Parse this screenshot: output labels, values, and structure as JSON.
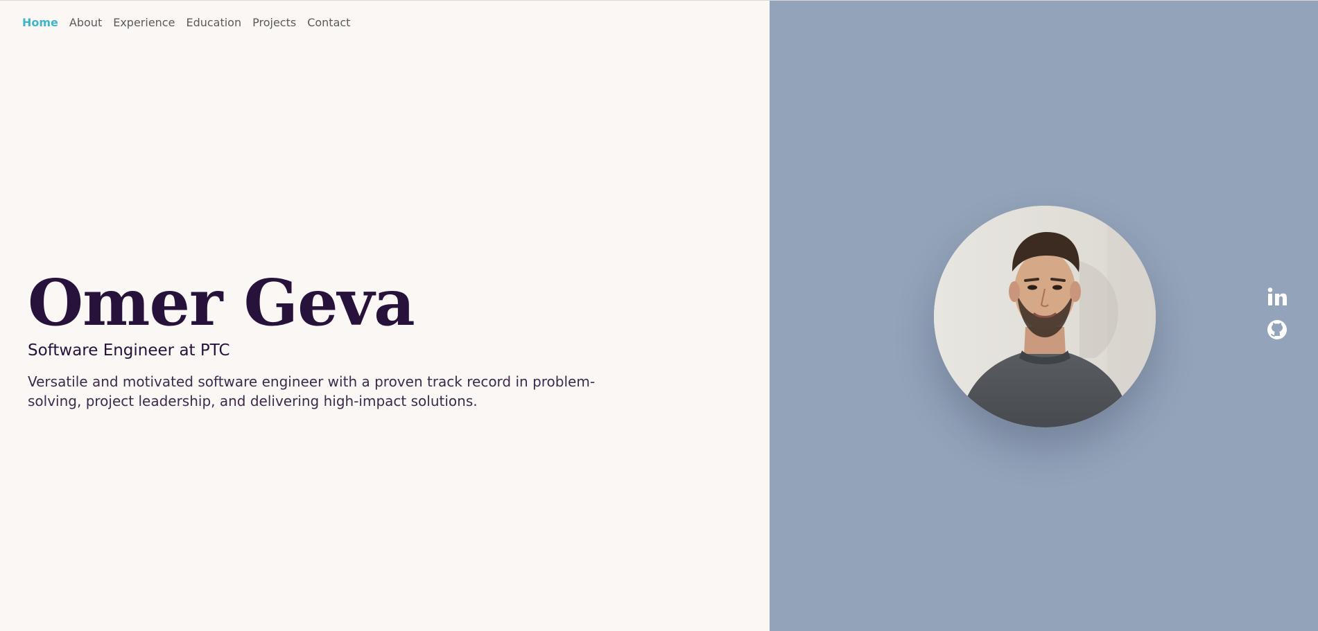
{
  "nav": {
    "items": [
      {
        "label": "Home",
        "active": true
      },
      {
        "label": "About",
        "active": false
      },
      {
        "label": "Experience",
        "active": false
      },
      {
        "label": "Education",
        "active": false
      },
      {
        "label": "Projects",
        "active": false
      },
      {
        "label": "Contact",
        "active": false
      }
    ]
  },
  "hero": {
    "name": "Omer Geva",
    "subtitle": "Software Engineer at PTC",
    "description": "Versatile and motivated software engineer with a proven track record in problem-solving, project leadership, and delivering high-impact solutions."
  },
  "profile": {
    "photo_icon": "profile-photo"
  },
  "social": {
    "linkedin_icon": "linkedin-icon",
    "github_icon": "github-icon"
  },
  "colors": {
    "accent": "#3fb6c8",
    "left_bg": "#faf7f5",
    "right_bg": "#93a3b9",
    "heading": "#26123a"
  }
}
